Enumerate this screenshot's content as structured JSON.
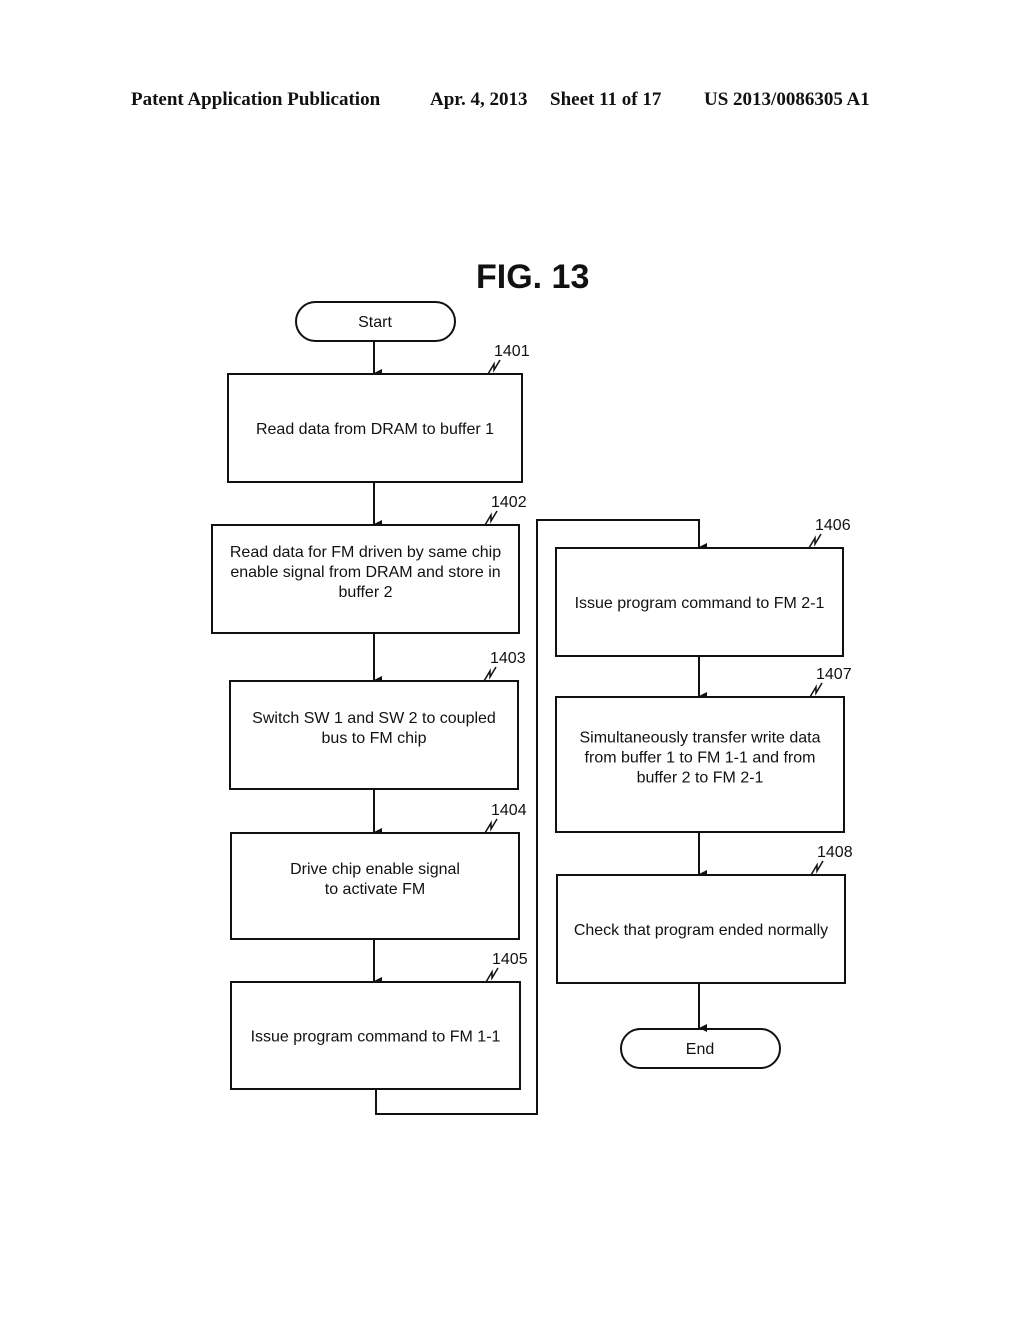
{
  "header": {
    "publication": "Patent Application Publication",
    "date": "Apr. 4, 2013",
    "sheet": "Sheet 11 of 17",
    "pub_number": "US 2013/0086305 A1"
  },
  "figure": {
    "title": "FIG. 13",
    "start_label": "Start",
    "end_label": "End",
    "steps": [
      {
        "ref": "1401",
        "lines": [
          "Read data from DRAM to buffer 1"
        ]
      },
      {
        "ref": "1402",
        "lines": [
          "Read data for FM driven by same chip",
          "enable signal from DRAM and store in",
          "buffer 2"
        ]
      },
      {
        "ref": "1403",
        "lines": [
          "Switch SW 1 and SW 2 to coupled",
          "bus to FM chip"
        ]
      },
      {
        "ref": "1404",
        "lines": [
          "Drive chip enable signal",
          "to activate FM"
        ]
      },
      {
        "ref": "1405",
        "lines": [
          "Issue program command to FM 1-1"
        ]
      },
      {
        "ref": "1406",
        "lines": [
          "Issue program command to FM 2-1"
        ]
      },
      {
        "ref": "1407",
        "lines": [
          "Simultaneously transfer write data",
          "from buffer 1 to FM 1-1 and from",
          "buffer 2 to FM 2-1"
        ]
      },
      {
        "ref": "1408",
        "lines": [
          "Check that program ended normally"
        ]
      }
    ]
  }
}
